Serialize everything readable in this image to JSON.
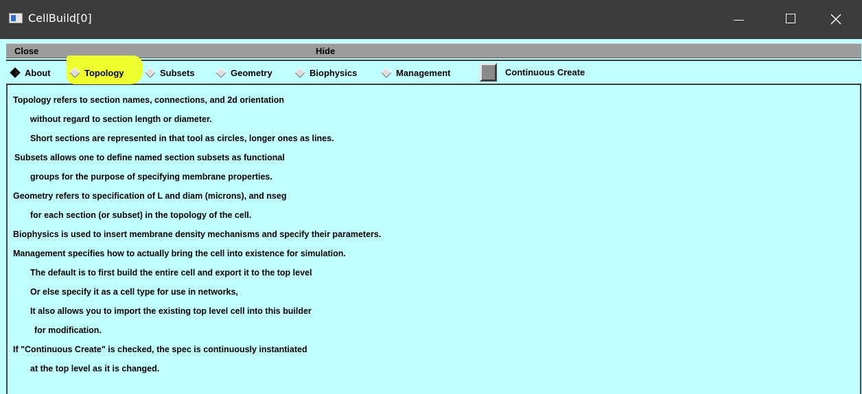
{
  "window": {
    "title": "CellBuild[0]"
  },
  "menubar": {
    "close_label": "Close",
    "hide_label": "Hide"
  },
  "tabs": [
    {
      "label": "About",
      "selected": true
    },
    {
      "label": "Topology",
      "selected": false,
      "highlighted": true
    },
    {
      "label": "Subsets",
      "selected": false
    },
    {
      "label": "Geometry",
      "selected": false
    },
    {
      "label": "Biophysics",
      "selected": false
    },
    {
      "label": "Management",
      "selected": false
    }
  ],
  "continuous_create": {
    "label": "Continuous Create",
    "checked": false
  },
  "about_text": [
    "Topology refers to section names, connections, and 2d orientation",
    "without regard to section length or diameter.",
    "Short sections are represented in that tool as circles, longer ones as lines.",
    "Subsets allows one to define named section subsets as functional",
    "groups for the purpose of specifying membrane properties.",
    "Geometry refers to specification of L and diam (microns), and nseg",
    "for each section (or subset) in the topology of the cell.",
    "Biophysics is used to insert membrane density mechanisms and specify their parameters.",
    "Management specifies how to actually bring the cell into existence for simulation.",
    "The default is to first build the entire cell and export it to the top level",
    "Or else specify it as a cell type for use in networks,",
    "It also allows you to import the existing top level cell into this builder",
    "for modification.",
    "If \"Continuous Create\" is checked, the spec is continuously instantiated",
    "at the top level as it is changed."
  ],
  "colors": {
    "titlebar": "#3c3c3c",
    "panel": "#c0ffff",
    "menubar": "#9c9c9c",
    "highlight": "#eeff30"
  }
}
